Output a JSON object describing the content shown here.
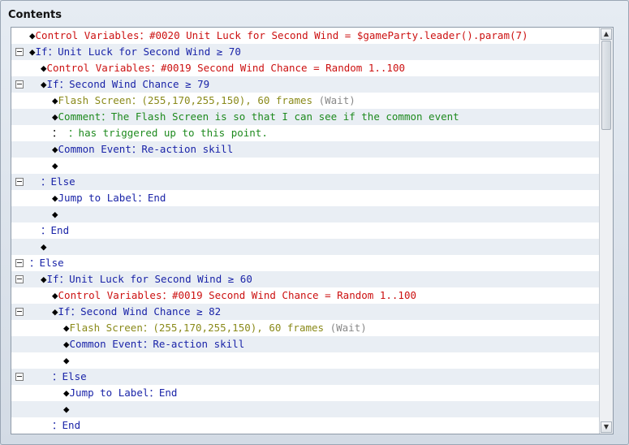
{
  "panel": {
    "title": "Contents"
  },
  "rows": [
    {
      "indent": 0,
      "fold": false,
      "parts": [
        [
          "dia",
          "◆"
        ],
        [
          "red",
          "Control Variables："
        ],
        [
          "red",
          "#0020 Unit Luck for Second Wind = $gameParty.leader().param(7)"
        ]
      ]
    },
    {
      "indent": 0,
      "fold": true,
      "parts": [
        [
          "dia",
          "◆"
        ],
        [
          "blue",
          "If："
        ],
        [
          "blue",
          "Unit Luck for Second Wind ≥ 70"
        ]
      ]
    },
    {
      "indent": 1,
      "fold": false,
      "parts": [
        [
          "dia",
          "◆"
        ],
        [
          "red",
          "Control Variables："
        ],
        [
          "red",
          "#0019 Second Wind Chance = Random 1..100"
        ]
      ]
    },
    {
      "indent": 1,
      "fold": true,
      "parts": [
        [
          "dia",
          "◆"
        ],
        [
          "blue",
          "If："
        ],
        [
          "blue",
          "Second Wind Chance ≥ 79"
        ]
      ]
    },
    {
      "indent": 2,
      "fold": false,
      "parts": [
        [
          "dia",
          "◆"
        ],
        [
          "olive",
          "Flash Screen："
        ],
        [
          "olive",
          "(255,170,255,150), 60 frames "
        ],
        [
          "gray",
          "(Wait)"
        ]
      ]
    },
    {
      "indent": 2,
      "fold": false,
      "parts": [
        [
          "dia",
          "◆"
        ],
        [
          "green",
          "Comment："
        ],
        [
          "green",
          "The Flash Screen is so that I can see if the common event"
        ]
      ]
    },
    {
      "indent": 2,
      "fold": false,
      "parts": [
        [
          "dia",
          "："
        ],
        [
          "green",
          "       ："
        ],
        [
          "green",
          "has triggered up to this point."
        ]
      ]
    },
    {
      "indent": 2,
      "fold": false,
      "parts": [
        [
          "dia",
          "◆"
        ],
        [
          "blue",
          "Common Event："
        ],
        [
          "blue",
          "Re-action skill"
        ]
      ]
    },
    {
      "indent": 2,
      "fold": false,
      "parts": [
        [
          "dia",
          "◆"
        ]
      ]
    },
    {
      "indent": 1,
      "fold": true,
      "parts": [
        [
          "blue",
          "："
        ],
        [
          "blue",
          "Else"
        ]
      ]
    },
    {
      "indent": 2,
      "fold": false,
      "parts": [
        [
          "dia",
          "◆"
        ],
        [
          "blue",
          "Jump to Label："
        ],
        [
          "blue",
          "End"
        ]
      ]
    },
    {
      "indent": 2,
      "fold": false,
      "parts": [
        [
          "dia",
          "◆"
        ]
      ]
    },
    {
      "indent": 1,
      "fold": false,
      "parts": [
        [
          "blue",
          "："
        ],
        [
          "blue",
          "End"
        ]
      ]
    },
    {
      "indent": 1,
      "fold": false,
      "parts": [
        [
          "dia",
          "◆"
        ]
      ]
    },
    {
      "indent": 0,
      "fold": true,
      "parts": [
        [
          "blue",
          "："
        ],
        [
          "blue",
          "Else"
        ]
      ]
    },
    {
      "indent": 1,
      "fold": true,
      "parts": [
        [
          "dia",
          "◆"
        ],
        [
          "blue",
          "If："
        ],
        [
          "blue",
          "Unit Luck for Second Wind ≥ 60"
        ]
      ]
    },
    {
      "indent": 2,
      "fold": false,
      "parts": [
        [
          "dia",
          "◆"
        ],
        [
          "red",
          "Control Variables："
        ],
        [
          "red",
          "#0019 Second Wind Chance = Random 1..100"
        ]
      ]
    },
    {
      "indent": 2,
      "fold": true,
      "parts": [
        [
          "dia",
          "◆"
        ],
        [
          "blue",
          "If："
        ],
        [
          "blue",
          "Second Wind Chance ≥ 82"
        ]
      ]
    },
    {
      "indent": 3,
      "fold": false,
      "parts": [
        [
          "dia",
          "◆"
        ],
        [
          "olive",
          "Flash Screen："
        ],
        [
          "olive",
          "(255,170,255,150), 60 frames "
        ],
        [
          "gray",
          "(Wait)"
        ]
      ]
    },
    {
      "indent": 3,
      "fold": false,
      "parts": [
        [
          "dia",
          "◆"
        ],
        [
          "blue",
          "Common Event："
        ],
        [
          "blue",
          "Re-action skill"
        ]
      ]
    },
    {
      "indent": 3,
      "fold": false,
      "parts": [
        [
          "dia",
          "◆"
        ]
      ]
    },
    {
      "indent": 2,
      "fold": true,
      "parts": [
        [
          "blue",
          "："
        ],
        [
          "blue",
          "Else"
        ]
      ]
    },
    {
      "indent": 3,
      "fold": false,
      "parts": [
        [
          "dia",
          "◆"
        ],
        [
          "blue",
          "Jump to Label："
        ],
        [
          "blue",
          "End"
        ]
      ]
    },
    {
      "indent": 3,
      "fold": false,
      "parts": [
        [
          "dia",
          "◆"
        ]
      ]
    },
    {
      "indent": 2,
      "fold": false,
      "parts": [
        [
          "blue",
          "："
        ],
        [
          "blue",
          "End"
        ]
      ]
    }
  ],
  "scrollbar": {
    "up_glyph": "▲",
    "down_glyph": "▼"
  }
}
